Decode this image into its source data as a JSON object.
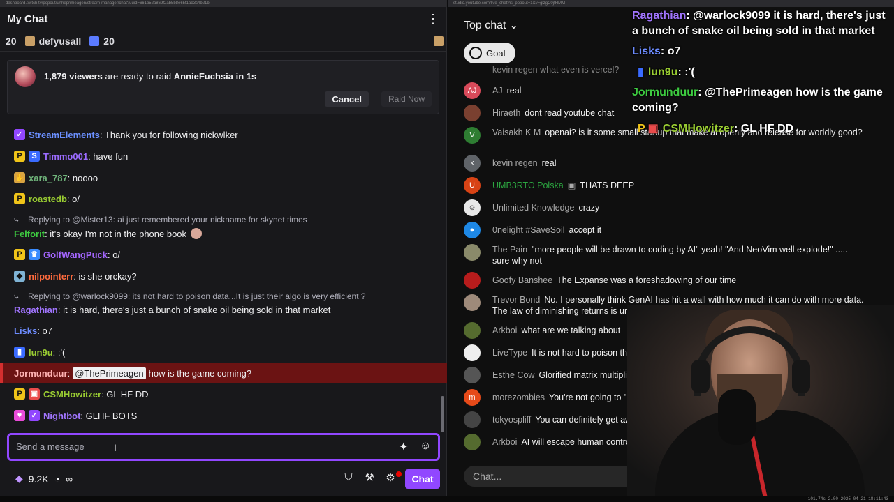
{
  "twitch": {
    "url": "dashboard.twitch.tv/popout/u/theprimeagen/stream-manager/chat?uuid=661b52a869f2ab5b8e65f1a93c4b21b",
    "header_title": "My Chat",
    "gift_bar": [
      {
        "count": "20"
      },
      {
        "name": "defyusall"
      },
      {
        "count": "20"
      }
    ],
    "raid": {
      "viewers": "1,879 viewers",
      "middle": " are ready to raid ",
      "target": "AnnieFuchsia in 1s",
      "cancel": "Cancel",
      "raid_now": "Raid Now"
    },
    "messages": [
      {
        "user": "StreamElements",
        "text": ": Thank you for following nickwlker",
        "color": "#6b90ff"
      },
      {
        "user": "Timmo001",
        "text": ": have fun",
        "color": "#9b6bff"
      },
      {
        "user": "xara_787",
        "text": ": noooo",
        "color": "#6fb37a"
      },
      {
        "user": "roastedb",
        "text": ": o/",
        "color": "#9acd32"
      },
      {
        "reply": "Replying to @Mister13: ai just remembered your nickname for skynet times"
      },
      {
        "user": "Felforit",
        "text": ": it's okay I'm not in the phone book",
        "color": "#3ecc41"
      },
      {
        "user": "GolfWangPuck",
        "text": ": o/",
        "color": "#a466ff"
      },
      {
        "user": "nilpointerr",
        "text": ": is she orckay?",
        "color": "#ff6a3d"
      },
      {
        "reply": "Replying to @warlock9099: its not hard to poison data...It is just their algo is very efficient ?"
      },
      {
        "user": "Ragathian",
        "text": ": it is hard, there's just a bunch of snake oil being sold in that market",
        "color": "#a175ff"
      },
      {
        "user": "Lisks",
        "text": ": o7",
        "color": "#6d8cff"
      },
      {
        "user": "lun9u",
        "text": ": :'(",
        "color": "#9acd32"
      },
      {
        "user": "Jormunduur",
        "text": "how is the game coming?",
        "mention": "@ThePrimeagen",
        "color": "#c9a0ff"
      },
      {
        "user": "CSMHowitzer",
        "text": ": GL HF DD",
        "color": "#9acd32"
      },
      {
        "user": "Nightbot",
        "text": ": GLHF BOTS",
        "color": "#a175ff"
      }
    ],
    "compose_placeholder": "Send a message",
    "points": "9.2K",
    "infinity": "∞",
    "chat_button": "Chat"
  },
  "youtube": {
    "url": "studio.youtube.com/live_chat?is_popout=1&v=glzgC0jtHMM",
    "top_chat": "Top chat",
    "goal": "Goal",
    "partial_top": "kevin regen   what even is vercel?",
    "messages": [
      {
        "initial": "AJ",
        "name": "AJ",
        "text": "real",
        "bg": "#d84a5a"
      },
      {
        "initial": "",
        "name": "Hiraeth",
        "text": "dont read youtube chat",
        "bg": "#7a4030"
      },
      {
        "initial": "V",
        "name": "Vaisakh K M",
        "text": "openai? is it some small startup that make ai openly and release for worldly good?",
        "bg": "#2e7d32"
      },
      {
        "initial": "k",
        "name": "kevin regen",
        "text": "real",
        "bg": "#5f6368"
      },
      {
        "initial": "U",
        "name": "UMB3RTO Polska",
        "text": "THATS DEEP",
        "bg": "#d84315",
        "green": true
      },
      {
        "initial": "",
        "name": "Unlimited Knowledge",
        "text": "crazy",
        "bg": "#e8e8e8"
      },
      {
        "initial": "",
        "name": "0nelight #SaveSoil",
        "text": "accept it",
        "bg": "#1e88e5"
      },
      {
        "initial": "",
        "name": "The Pain",
        "text": "\"more people will be drawn to coding by AI\" yeah! \"And NeoVim well explode!\" ..... sure why not",
        "bg": "#8a8a6a"
      },
      {
        "initial": "",
        "name": "Goofy Banshee",
        "text": "The Expanse was a foreshadowing of our time",
        "bg": "#b71c1c"
      },
      {
        "initial": "",
        "name": "Trevor Bond",
        "text": "No. I personally think GenAI has hit a wall with how much it can do with more data. The law of diminishing returns is universal.",
        "bg": "#9e8a7a"
      },
      {
        "initial": "",
        "name": "Arkboi",
        "text": "what are we talking about",
        "bg": "#556b2f"
      },
      {
        "initial": "",
        "name": "LiveType",
        "text": "It is not hard to poison the data, it's generally ... you",
        "bg": "#eeeeee"
      },
      {
        "initial": "",
        "name": "Esthe Cow",
        "text": "Glorified matrix multiplication, glorified auto ... bruteforce",
        "bg": "#555555"
      },
      {
        "initial": "m",
        "name": "morezombies",
        "text": "You're not going to \"poison th... ur time",
        "bg": "#e64a19"
      },
      {
        "initial": "",
        "name": "tokyospliff",
        "text": "You can definitely get away",
        "bg": "#444444"
      },
      {
        "initial": "",
        "name": "Arkboi",
        "text": "AI will escape human control",
        "bg": "#556b2f"
      }
    ],
    "input_placeholder": "Chat..."
  },
  "overlay": [
    {
      "user": "Ragathian",
      "text": ": @warlock9099 it is hard, there's just",
      "color": "#a175ff"
    },
    {
      "user": "",
      "text": "a bunch of snake oil being sold in that market",
      "color": "#ffffff"
    },
    {
      "user": "Lisks",
      "text": ": o7",
      "color": "#6d8cff"
    },
    {
      "user": "lun9u",
      "text": ": :'(",
      "color": "#9acd32"
    },
    {
      "user": "Jormunduur",
      "text": ": @ThePrimeagen how is the game",
      "color": "#3ecc41"
    },
    {
      "user": "",
      "text": "coming?",
      "color": "#ffffff"
    },
    {
      "user": "CSMHowitzer",
      "text": ": GL HF DD",
      "color": "#9acd32"
    }
  ],
  "status_bar": "101.74s 2.00 2025-04-21 18:11:43"
}
